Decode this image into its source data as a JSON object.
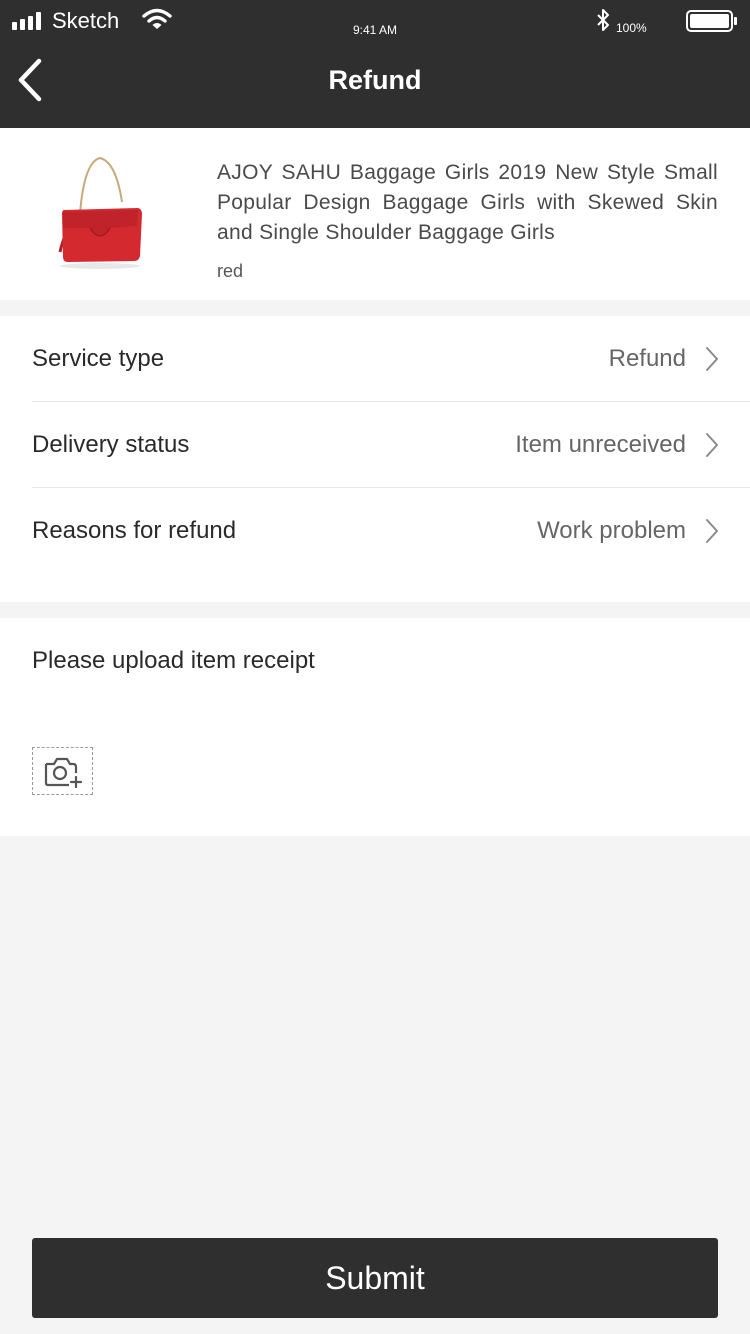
{
  "status_bar": {
    "carrier": "Sketch",
    "time": "9:41 AM",
    "battery_percent": "100%",
    "icons": [
      "signal-icon",
      "wifi-icon",
      "bluetooth-icon",
      "battery-icon"
    ]
  },
  "nav": {
    "title": "Refund",
    "back_icon": "chevron-left-icon"
  },
  "product": {
    "title": "AJOY SAHU Baggage Girls 2019 New Style Small Popular Design Baggage Girls with Skewed Skin and Single Shoulder Baggage Girls",
    "variant": "red",
    "image": "red-handbag-image"
  },
  "options": [
    {
      "label": "Service type",
      "value": "Refund"
    },
    {
      "label": "Delivery status",
      "value": "Item unreceived"
    },
    {
      "label": "Reasons for refund",
      "value": "Work problem"
    }
  ],
  "upload": {
    "label": "Please upload item receipt",
    "icon": "camera-add-icon"
  },
  "submit": {
    "label": "Submit"
  },
  "colors": {
    "header_bg": "#2f2f2f",
    "page_bg": "#f4f4f4",
    "card_bg": "#ffffff",
    "primary_text": "#2a2a2a",
    "secondary_text": "#666666",
    "button_bg": "#2f2f2f",
    "product_red": "#d42a2f"
  }
}
